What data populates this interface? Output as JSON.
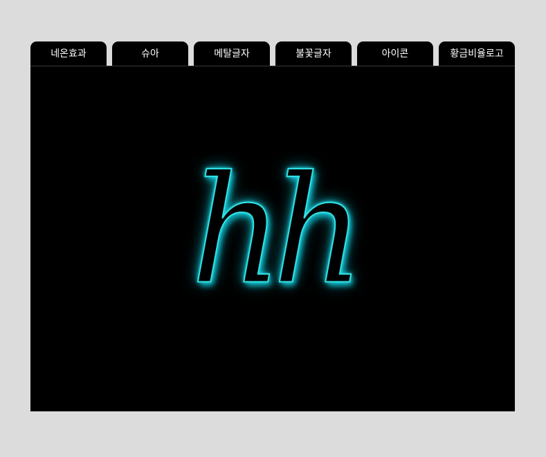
{
  "tabs": [
    {
      "label": "네온효과"
    },
    {
      "label": "슈아"
    },
    {
      "label": "메탈글자"
    },
    {
      "label": "불꽃글자"
    },
    {
      "label": "아이콘"
    },
    {
      "label": "황금비율로고"
    }
  ],
  "stage": {
    "text": "hh",
    "glow_color": "#2fe0e6",
    "background": "#000000"
  }
}
